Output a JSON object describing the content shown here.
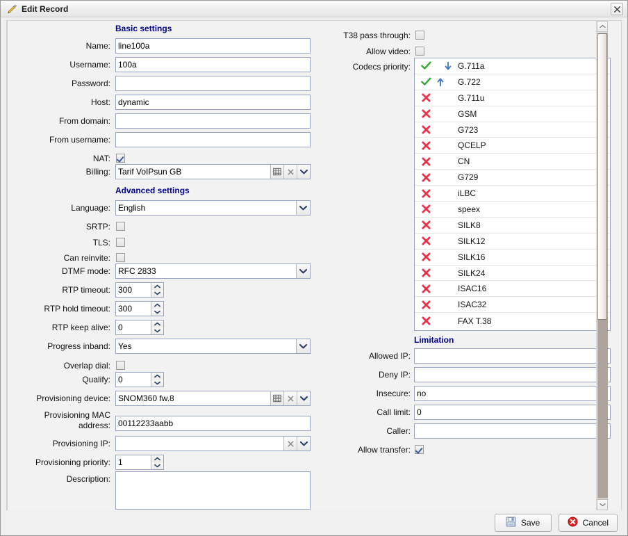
{
  "window": {
    "title": "Edit Record",
    "title_icon": "pencil-icon",
    "close_icon": "close-icon"
  },
  "sections": {
    "basic": "Basic settings",
    "advanced": "Advanced settings",
    "limitation": "Limitation"
  },
  "basic_fields": {
    "name": {
      "label": "Name:",
      "value": "line100a"
    },
    "username": {
      "label": "Username:",
      "value": "100a"
    },
    "password": {
      "label": "Password:",
      "value": ""
    },
    "host": {
      "label": "Host:",
      "value": "dynamic"
    },
    "from_domain": {
      "label": "From domain:",
      "value": ""
    },
    "from_username": {
      "label": "From username:",
      "value": ""
    },
    "nat": {
      "label": "NAT:",
      "checked": true
    },
    "billing": {
      "label": "Billing:",
      "value": "Tarif VoIPsun GB"
    }
  },
  "advanced_fields": {
    "language": {
      "label": "Language:",
      "value": "English"
    },
    "srtp": {
      "label": "SRTP:",
      "checked": false
    },
    "tls": {
      "label": "TLS:",
      "checked": false
    },
    "can_reinvite": {
      "label": "Can reinvite:",
      "checked": false
    },
    "dtmf_mode": {
      "label": "DTMF mode:",
      "value": "RFC 2833"
    },
    "rtp_timeout": {
      "label": "RTP timeout:",
      "value": "300"
    },
    "rtp_hold_timeout": {
      "label": "RTP hold timeout:",
      "value": "300"
    },
    "rtp_keep_alive": {
      "label": "RTP keep alive:",
      "value": "0"
    },
    "progress_inband": {
      "label": "Progress inband:",
      "value": "Yes"
    },
    "overlap_dial": {
      "label": "Overlap dial:",
      "checked": false
    },
    "qualify": {
      "label": "Qualify:",
      "value": "0"
    },
    "provisioning_device": {
      "label": "Provisioning device:",
      "value": "SNOM360 fw.8"
    },
    "provisioning_mac": {
      "label_line1": "Provisioning MAC",
      "label_line2": "address:",
      "value": "00112233aabb"
    },
    "provisioning_ip": {
      "label": "Provisioning IP:",
      "value": ""
    },
    "provisioning_priority": {
      "label": "Provisioning priority:",
      "value": "1"
    },
    "description": {
      "label": "Description:",
      "value": ""
    }
  },
  "right_fields": {
    "t38_pass_through": {
      "label": "T38 pass through:",
      "checked": false
    },
    "allow_video": {
      "label": "Allow video:",
      "checked": false
    },
    "codecs_priority": {
      "label": "Codecs priority:"
    }
  },
  "codecs": [
    {
      "name": "G.711a",
      "enabled": true,
      "move": "down"
    },
    {
      "name": "G.722",
      "enabled": true,
      "move": "up"
    },
    {
      "name": "G.711u",
      "enabled": false,
      "move": ""
    },
    {
      "name": "GSM",
      "enabled": false,
      "move": ""
    },
    {
      "name": "G723",
      "enabled": false,
      "move": ""
    },
    {
      "name": "QCELP",
      "enabled": false,
      "move": ""
    },
    {
      "name": "CN",
      "enabled": false,
      "move": ""
    },
    {
      "name": "G729",
      "enabled": false,
      "move": ""
    },
    {
      "name": "iLBC",
      "enabled": false,
      "move": ""
    },
    {
      "name": "speex",
      "enabled": false,
      "move": ""
    },
    {
      "name": "SILK8",
      "enabled": false,
      "move": ""
    },
    {
      "name": "SILK12",
      "enabled": false,
      "move": ""
    },
    {
      "name": "SILK16",
      "enabled": false,
      "move": ""
    },
    {
      "name": "SILK24",
      "enabled": false,
      "move": ""
    },
    {
      "name": "ISAC16",
      "enabled": false,
      "move": ""
    },
    {
      "name": "ISAC32",
      "enabled": false,
      "move": ""
    },
    {
      "name": "FAX T.38",
      "enabled": false,
      "move": ""
    }
  ],
  "limitation_fields": {
    "allowed_ip": {
      "label": "Allowed IP:",
      "value": ""
    },
    "deny_ip": {
      "label": "Deny IP:",
      "value": ""
    },
    "insecure": {
      "label": "Insecure:",
      "value": "no"
    },
    "call_limit": {
      "label": "Call limit:",
      "value": "0"
    },
    "caller": {
      "label": "Caller:",
      "value": ""
    },
    "allow_transfer": {
      "label": "Allow transfer:",
      "checked": true
    }
  },
  "footer": {
    "save_label": "Save",
    "cancel_label": "Cancel",
    "save_icon": "floppy-disk-icon",
    "cancel_icon": "cancel-circle-icon"
  },
  "colors": {
    "section_heading": "#00008f",
    "field_border": "#9aa3bd",
    "enabled_codec": "#36a832",
    "disabled_codec": "#e8324a",
    "move_arrow": "#3f78c8"
  }
}
